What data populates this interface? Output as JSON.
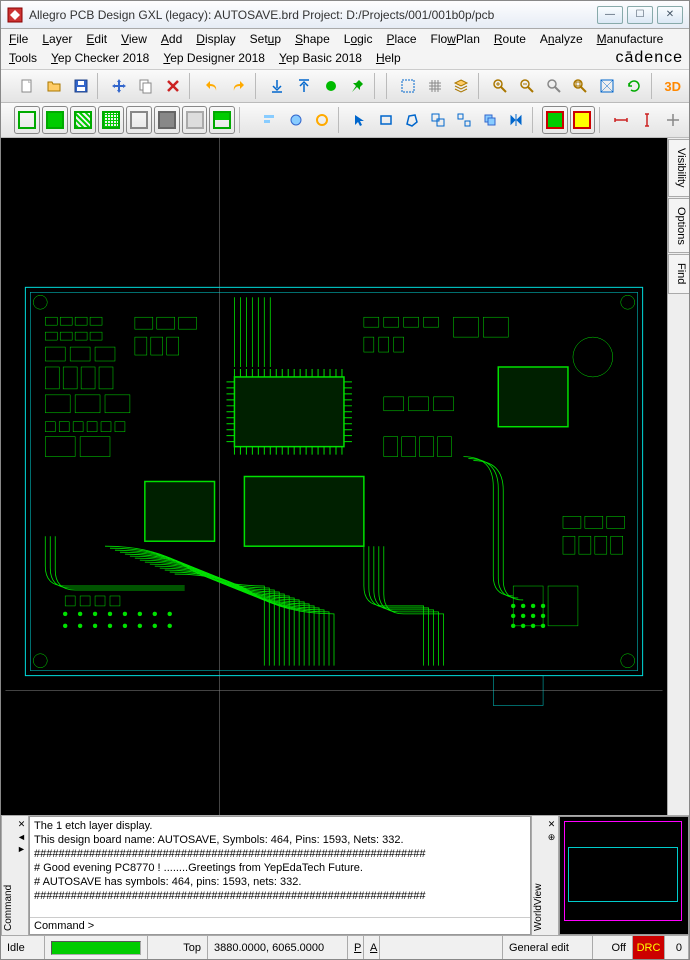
{
  "titlebar": {
    "title": "Allegro PCB Design GXL (legacy): AUTOSAVE.brd  Project: D:/Projects/001/001b0p/pcb"
  },
  "menu": {
    "items": [
      "File",
      "Layer",
      "Edit",
      "View",
      "Add",
      "Display",
      "Setup",
      "Shape",
      "Logic",
      "Place",
      "FlowPlan",
      "Route",
      "Analyze",
      "Manufacture",
      "Tools",
      "Yep Checker 2018",
      "Yep Designer 2018",
      "Yep Basic 2018",
      "Help"
    ],
    "brand": "cādence"
  },
  "toolbar1": {
    "icons": [
      "new-file",
      "open-file",
      "save-file",
      "sep",
      "move",
      "copy",
      "delete",
      "sep",
      "undo",
      "redo",
      "sep",
      "anchor-down",
      "anchor-up",
      "sep",
      "flag-green",
      "pin-green",
      "sep",
      "sep",
      "select-box",
      "grid-toggle",
      "layers",
      "sep",
      "zoom-in",
      "zoom-out",
      "zoom-fit",
      "zoom-window",
      "zoom-region",
      "refresh",
      "sep",
      "view-3d"
    ]
  },
  "toolbar2": {
    "icons": [
      "layer-outline",
      "layer-fill",
      "layer-hatch",
      "layer-cross",
      "layer-dim",
      "layer-grey",
      "layer-off",
      "layer-alt",
      "sep",
      "align-left",
      "align-center",
      "align-right",
      "sep",
      "arrow-tool",
      "rect-tool",
      "poly-tool",
      "group-tool",
      "ungroup-tool",
      "copy-shape",
      "mirror",
      "sep",
      "highlight-a",
      "highlight-b",
      "sep",
      "dim-h",
      "dim-v",
      "dim-both"
    ]
  },
  "sidepanel": {
    "tabs": [
      "Visibility",
      "Options",
      "Find"
    ]
  },
  "command": {
    "label": "Command",
    "lines": [
      "The 1 etch layer display.",
      "This design board name: AUTOSAVE, Symbols: 464, Pins: 1593, Nets: 332.",
      "################################################################",
      "#  Good evening PC8770 !     ........Greetings from YepEdaTech Future.",
      "#  AUTOSAVE has symbols: 464, pins: 1593, nets: 332.",
      "################################################################"
    ],
    "prompt": "Command >"
  },
  "worldview": {
    "label": "WorldView"
  },
  "status": {
    "state": "Idle",
    "layer": "Top",
    "coords": "3880.0000, 6065.0000",
    "p": "P",
    "a": "A",
    "mode": "General edit",
    "snap": "Off",
    "drc": "DRC",
    "drc_count": "0"
  }
}
